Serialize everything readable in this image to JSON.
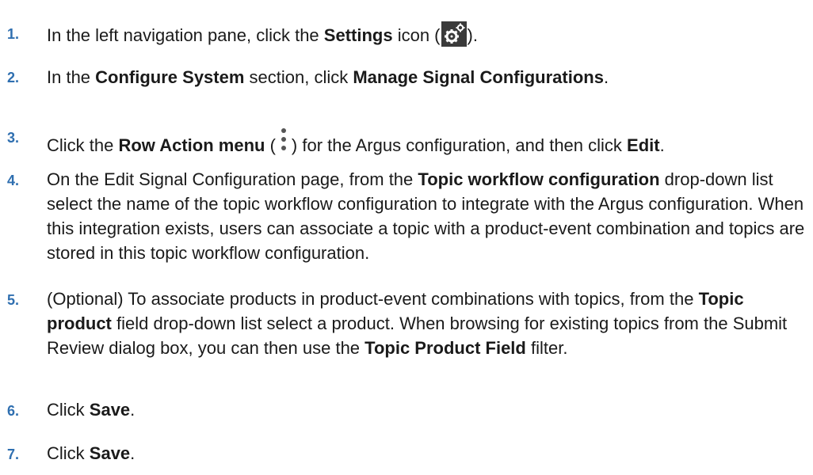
{
  "steps": [
    {
      "number": "1.",
      "parts": [
        "In the left navigation pane, click the ",
        "Settings",
        " icon (",
        ")."
      ]
    },
    {
      "number": "2.",
      "parts": [
        "In the ",
        "Configure System",
        " section, click ",
        "Manage Signal Configurations",
        "."
      ]
    },
    {
      "number": "3.",
      "parts": [
        "Click the ",
        "Row Action menu",
        " (",
        ") for the Argus configuration, and then click ",
        "Edit",
        "."
      ]
    },
    {
      "number": "4.",
      "parts": [
        "On the Edit Signal Configuration page, from the ",
        "Topic workflow configuration",
        " drop-down list select the name of the topic workflow configuration to integrate with the Argus configuration. When this integration exists, users can associate a topic with a product-event combination and topics are stored in this topic workflow configuration."
      ]
    },
    {
      "number": "5.",
      "parts": [
        "(Optional) To associate products in product-event combinations with topics, from the ",
        "Topic product",
        " field drop-down list select a product. When browsing for existing topics from the Submit Review dialog box, you can then use the ",
        "Topic Product Field",
        " filter."
      ]
    },
    {
      "number": "6.",
      "parts": [
        "Click ",
        "Save",
        "."
      ]
    },
    {
      "number": "7.",
      "parts": [
        "Click ",
        "Save",
        "."
      ]
    }
  ],
  "icons": {
    "settings": "gear-icon",
    "row_action": "kebab-icon"
  },
  "colors": {
    "step_number": "#2f6fb0",
    "text": "#1a1a1a",
    "settings_icon_bg": "#3a3a3a"
  }
}
